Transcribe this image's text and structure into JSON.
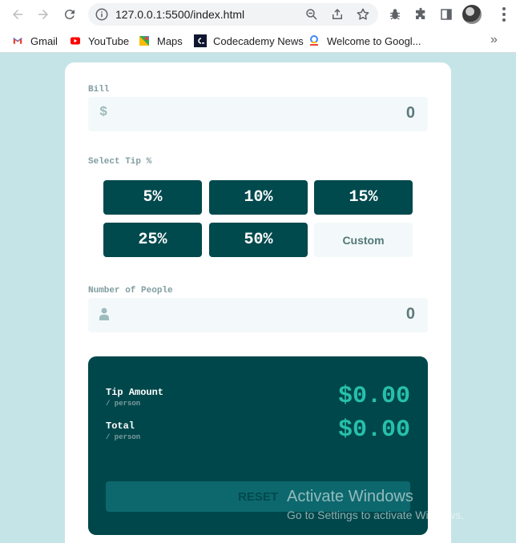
{
  "browser": {
    "url": "127.0.0.1:5500/index.html",
    "bookmarks": [
      {
        "label": "Gmail",
        "icon": "gmail-icon"
      },
      {
        "label": "YouTube",
        "icon": "youtube-icon"
      },
      {
        "label": "Maps",
        "icon": "maps-icon"
      },
      {
        "label": "Codecademy News",
        "icon": "codecademy-icon"
      },
      {
        "label": "Welcome to Googl...",
        "icon": "google-cloud-icon"
      }
    ],
    "more": "»"
  },
  "app": {
    "bill": {
      "label": "Bill",
      "currency": "$",
      "value": "0"
    },
    "tip": {
      "label": "Select Tip %",
      "options": [
        "5%",
        "10%",
        "15%",
        "25%",
        "50%"
      ],
      "custom": "Custom"
    },
    "people": {
      "label": "Number of People",
      "value": "0"
    },
    "result": {
      "tip_label": "Tip Amount",
      "tip_sub": "/ person",
      "tip_value": "$0.00",
      "total_label": "Total",
      "total_sub": "/ person",
      "total_value": "$0.00",
      "reset": "RESET"
    }
  },
  "watermark": {
    "title": "Activate Windows",
    "subtitle": "Go to Settings to activate Windows."
  },
  "colors": {
    "background": "#c5e4e7",
    "dark_cyan": "#00474b",
    "strong_cyan": "#26c0ab",
    "input_bg": "#f3f9fa"
  }
}
